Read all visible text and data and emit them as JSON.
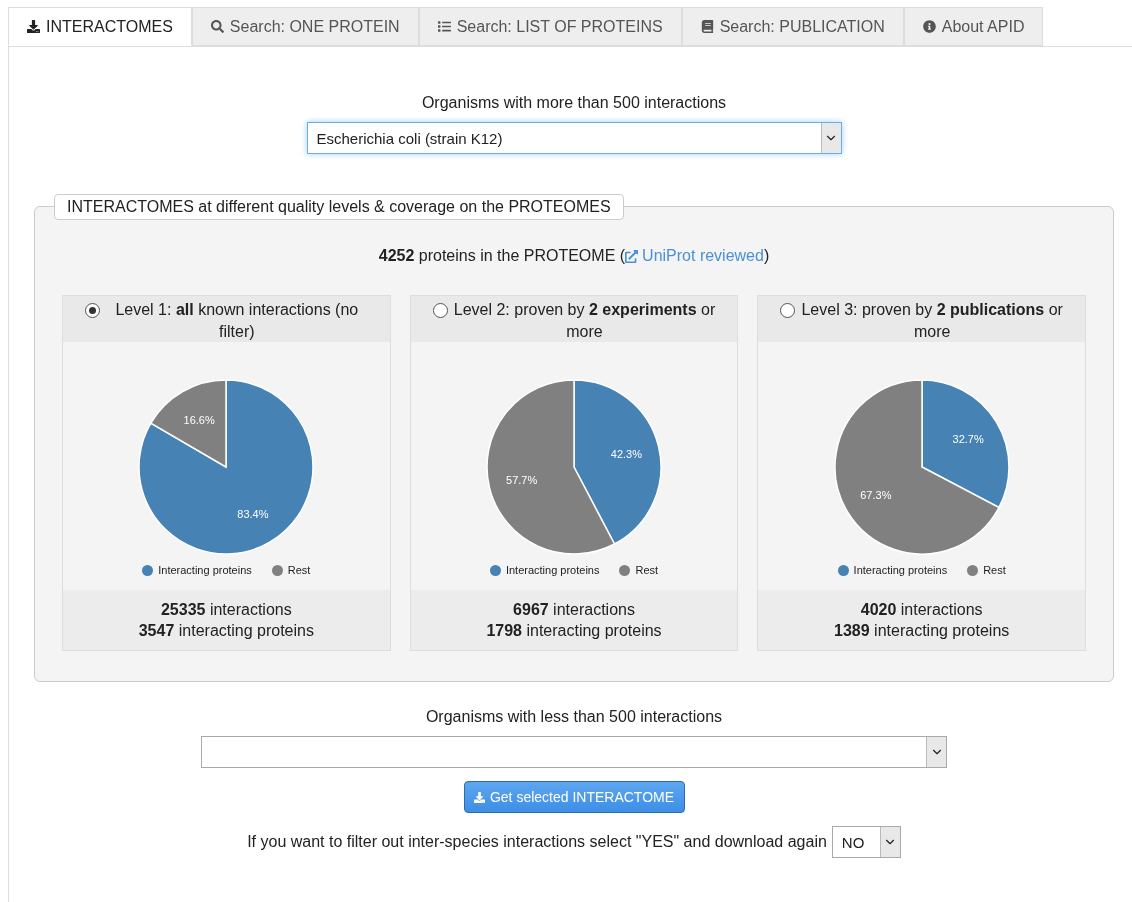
{
  "tabs": [
    {
      "label": "INTERACTOMES",
      "selected": true
    },
    {
      "label": "Search: ONE PROTEIN",
      "selected": false
    },
    {
      "label": "Search: LIST OF PROTEINS",
      "selected": false
    },
    {
      "label": "Search: PUBLICATION",
      "selected": false
    },
    {
      "label": "About APID",
      "selected": false
    }
  ],
  "major_organisms": {
    "label": "Organisms with more than 500 interactions",
    "value": "Escherichia coli (strain K12)"
  },
  "quality_panel": {
    "legend": "INTERACTOMES at different quality levels & coverage on the PROTEOMES",
    "proteome_text": "**4252** proteins in the PROTEOME (",
    "proteome_link": "UniProt reviewed",
    "proteome_end": ")",
    "levels": [
      {
        "title": "Level 1: **all** known interactions (no filter)",
        "selected": true,
        "chart_data": {
          "type": "pie",
          "categories": [
            "Interacting proteins",
            "Rest"
          ],
          "values": [
            83.4,
            16.6
          ],
          "colors": [
            "#4682b4",
            "#808080"
          ],
          "value_labels": [
            "83.4%",
            "16.6%"
          ]
        },
        "interactions": "**25335** interactions",
        "proteins": "**3547** interacting proteins"
      },
      {
        "title": "Level 2: proven by **2 experiments** or more",
        "selected": false,
        "chart_data": {
          "type": "pie",
          "categories": [
            "Interacting proteins",
            "Rest"
          ],
          "values": [
            42.3,
            57.7
          ],
          "colors": [
            "#4682b4",
            "#808080"
          ],
          "value_labels": [
            "42.3%",
            "57.7%"
          ]
        },
        "interactions": "**6967** interactions",
        "proteins": "**1798** interacting proteins"
      },
      {
        "title": "Level 3: proven by **2 publications** or more",
        "selected": false,
        "chart_data": {
          "type": "pie",
          "categories": [
            "Interacting proteins",
            "Rest"
          ],
          "values": [
            32.7,
            67.3
          ],
          "colors": [
            "#4682b4",
            "#808080"
          ],
          "value_labels": [
            "32.7%",
            "67.3%"
          ]
        },
        "interactions": "**4020** interactions",
        "proteins": "**1389** interacting proteins"
      }
    ]
  },
  "minor_organisms": {
    "label": "Organisms with less than 500 interactions"
  },
  "download_button": "Get selected INTERACTOME",
  "filter": {
    "text": "If you want to filter out inter-species interactions select \"YES\" and download again",
    "value": "NO"
  }
}
